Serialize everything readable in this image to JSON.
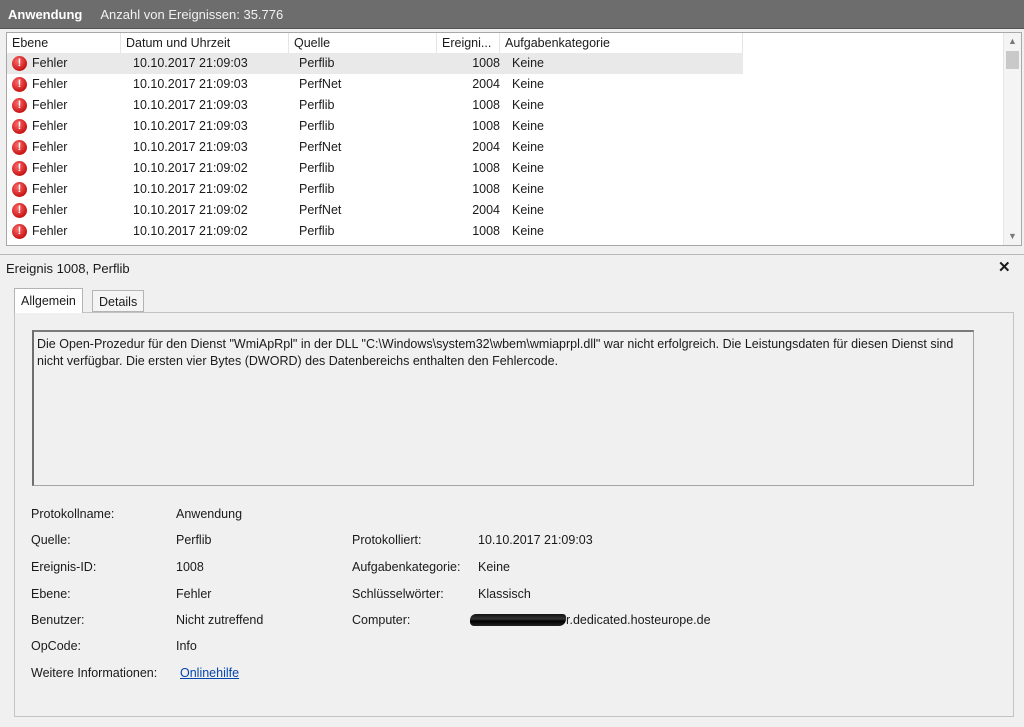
{
  "window": {
    "app_name": "Anwendung",
    "event_count": "Anzahl von Ereignissen: 35.776"
  },
  "table": {
    "columns": [
      "Ebene",
      "Datum und Uhrzeit",
      "Quelle",
      "Ereigni...",
      "Aufgabenkategorie"
    ],
    "rows": [
      {
        "level": "Fehler",
        "datetime": "10.10.2017 21:09:03",
        "source": "Perflib",
        "event_id": "1008",
        "category": "Keine"
      },
      {
        "level": "Fehler",
        "datetime": "10.10.2017 21:09:03",
        "source": "PerfNet",
        "event_id": "2004",
        "category": "Keine"
      },
      {
        "level": "Fehler",
        "datetime": "10.10.2017 21:09:03",
        "source": "Perflib",
        "event_id": "1008",
        "category": "Keine"
      },
      {
        "level": "Fehler",
        "datetime": "10.10.2017 21:09:03",
        "source": "Perflib",
        "event_id": "1008",
        "category": "Keine"
      },
      {
        "level": "Fehler",
        "datetime": "10.10.2017 21:09:03",
        "source": "PerfNet",
        "event_id": "2004",
        "category": "Keine"
      },
      {
        "level": "Fehler",
        "datetime": "10.10.2017 21:09:02",
        "source": "Perflib",
        "event_id": "1008",
        "category": "Keine"
      },
      {
        "level": "Fehler",
        "datetime": "10.10.2017 21:09:02",
        "source": "Perflib",
        "event_id": "1008",
        "category": "Keine"
      },
      {
        "level": "Fehler",
        "datetime": "10.10.2017 21:09:02",
        "source": "PerfNet",
        "event_id": "2004",
        "category": "Keine"
      },
      {
        "level": "Fehler",
        "datetime": "10.10.2017 21:09:02",
        "source": "Perflib",
        "event_id": "1008",
        "category": "Keine"
      }
    ]
  },
  "detail": {
    "title": "Ereignis 1008, Perflib",
    "close_icon": "✕",
    "tabs": [
      "Allgemein",
      "Details"
    ],
    "description": "Die Open-Prozedur für den Dienst \"WmiApRpl\" in der DLL \"C:\\Windows\\system32\\wbem\\wmiaprpl.dll\" war nicht erfolgreich. Die Leistungsdaten für diesen Dienst sind nicht verfügbar. Die ersten vier Bytes (DWORD) des Datenbereichs enthalten den Fehlercode.",
    "fields": {
      "log_name_label": "Protokollname:",
      "log_name": "Anwendung",
      "source_label": "Quelle:",
      "source": "Perflib",
      "logged_label": "Protokolliert:",
      "logged": "10.10.2017 21:09:03",
      "event_id_label": "Ereignis-ID:",
      "event_id": "1008",
      "task_category_label": "Aufgabenkategorie:",
      "task_category": "Keine",
      "level_label": "Ebene:",
      "level": "Fehler",
      "keywords_label": "Schlüsselwörter:",
      "keywords": "Klassisch",
      "user_label": "Benutzer:",
      "user": "Nicht zutreffend",
      "computer_label": "Computer:",
      "computer_suffix": "r.dedicated.hosteurope.de",
      "opcode_label": "OpCode:",
      "opcode": "Info",
      "more_info_label": "Weitere Informationen:",
      "more_info_link": "Onlinehilfe"
    }
  },
  "icons": {
    "error_icon": "error-icon",
    "close_icon": "close-icon",
    "scroll_up_icon": "chevron-up-icon",
    "scroll_down_icon": "chevron-down-icon"
  },
  "colors": {
    "titlebar": "#6d6d6d",
    "error_red": "#c81414",
    "link_blue": "#0645ad",
    "selected_row": "#e9e9e9"
  }
}
